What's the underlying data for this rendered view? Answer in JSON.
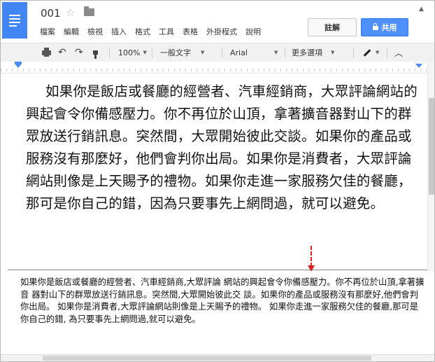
{
  "header": {
    "title": "001",
    "menu": [
      "檔案",
      "編輯",
      "檢視",
      "插入",
      "格式",
      "工具",
      "表格",
      "外掛程式",
      "說明"
    ],
    "comment_label": "註解",
    "share_label": "共用",
    "collapse_glyph": "▲"
  },
  "toolbar": {
    "zoom": "100%",
    "style": "一般文字",
    "font": "Arial",
    "more": "更多選項",
    "undo_glyph": "↶",
    "redo_glyph": "↷",
    "caret": "▼",
    "collapse_glyph": "︿"
  },
  "document": {
    "body_text": "如果你是飯店或餐廳的經營者、汽車經銷商，大眾評論網站的興起會令你備感壓力。你不再位於山頂，拿著擴音器對山下的群眾放送行銷訊息。突然間，大眾開始彼此交談。如果你的產品或服務沒有那麼好，他們會判你出局。如果你是消費者，大眾評論網站則像是上天賜予的禮物。如果你走進一家服務欠佳的餐廳，那可是你自己的錯，因為只要事先上網問過，就可以避免。"
  },
  "ocr_panel": {
    "text": "如果你是飯店或餐廳的經營者、汽車經銷商,大眾評論 網站的興起會令你備感壓力。你不再位於山頂,拿著擴音 器對山下的群眾放送行銷訊息。突然間,大眾開始彼此交 談。如果你的產品或服務沒有那麼好,他們會判你出局。 如果你是消費者,大眾評論網站則像是上天賜予的禮物。 如果你走進一家服務欠佳的餐廳,那可是你自己的錯, 為只要事先上網問過,就可以避免。"
  },
  "icons": [
    "docs-logo-icon",
    "star-icon",
    "folder-icon",
    "lock-icon",
    "print-icon",
    "undo-icon",
    "redo-icon",
    "paint-format-icon",
    "pen-icon",
    "chevron-up-icon"
  ],
  "colors": {
    "brand": "#4285f4",
    "share": "#4d90fe",
    "annotation_arrow": "#dd2222"
  }
}
